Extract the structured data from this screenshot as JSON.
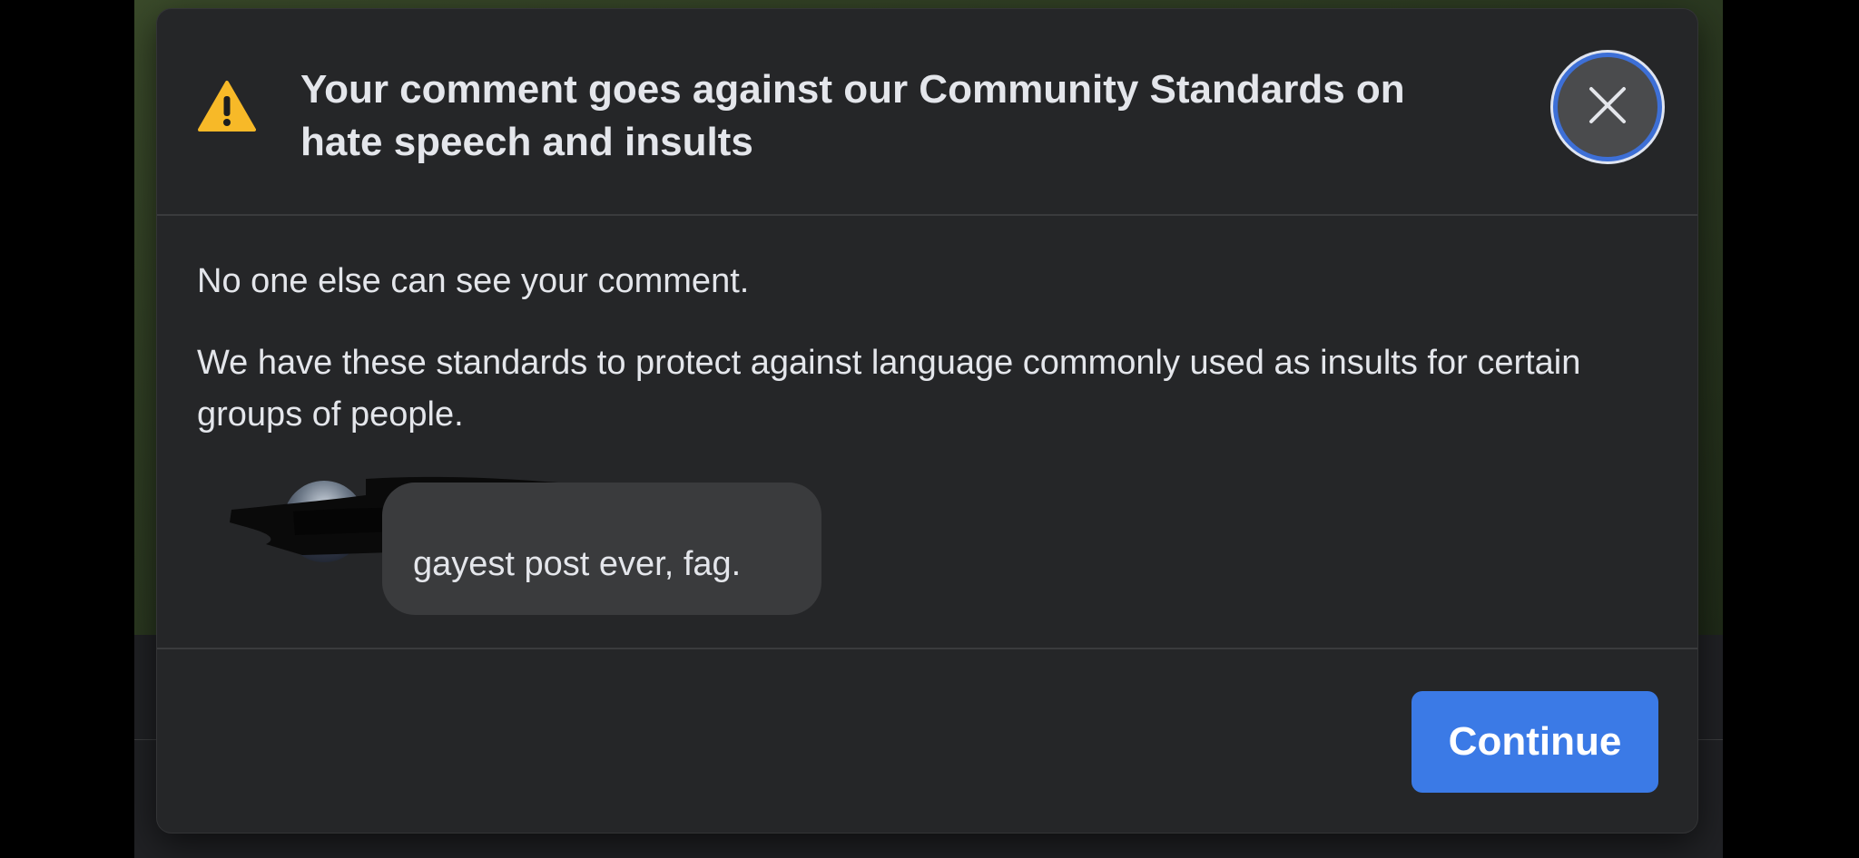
{
  "dialog": {
    "title": "Your comment goes against our Community Standards on hate speech and insults",
    "warning_icon": "warning-triangle-icon",
    "close_icon": "close-icon",
    "message_1": "No one else can see your comment.",
    "message_2": "We have these standards to protect against language commonly used as insults for certain groups of people.",
    "comment": {
      "text": "gayest post ever, fag."
    },
    "continue_label": "Continue"
  },
  "colors": {
    "dialog_bg": "#252628",
    "text": "#e4e6eb",
    "accent": "#3b7ae6",
    "warning": "#f7b928",
    "bubble_bg": "#3a3b3d"
  }
}
